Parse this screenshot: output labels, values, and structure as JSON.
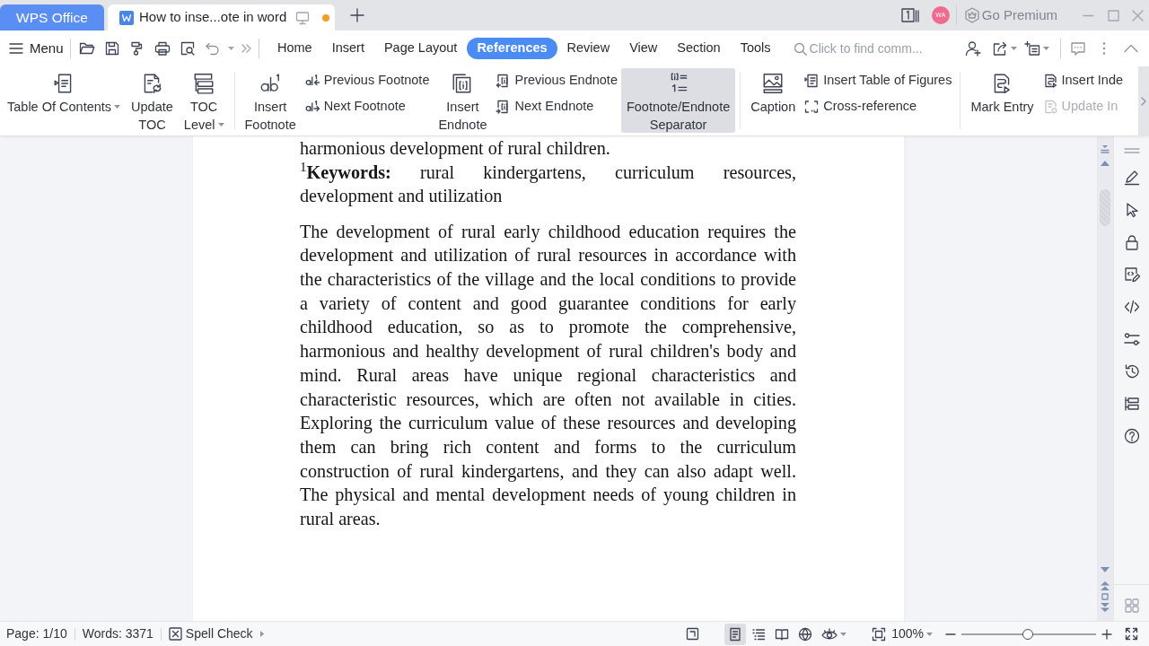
{
  "window": {
    "app_tab": "WPS Office",
    "doc_tab": {
      "title": "How to inse...ote in word",
      "modified": true
    },
    "avatar": "WA",
    "premium": "Go Premium"
  },
  "menu_bar": {
    "menu": "Menu",
    "tabs": [
      {
        "label": "Home",
        "selected": false
      },
      {
        "label": "Insert",
        "selected": false
      },
      {
        "label": "Page Layout",
        "selected": false
      },
      {
        "label": "References",
        "selected": true
      },
      {
        "label": "Review",
        "selected": false
      },
      {
        "label": "View",
        "selected": false
      },
      {
        "label": "Section",
        "selected": false
      },
      {
        "label": "Tools",
        "selected": false
      }
    ],
    "search": {
      "placeholder": "Click to find comm..."
    }
  },
  "ribbon": {
    "groups": [
      {
        "items": [
          {
            "kind": "large",
            "lines": [
              "Table Of Contents"
            ],
            "dropdown": true,
            "hovered": false
          },
          {
            "kind": "large",
            "lines": [
              "Update",
              "TOC"
            ],
            "dropdown": false,
            "hovered": false
          },
          {
            "kind": "large",
            "lines": [
              "TOC",
              "Level"
            ],
            "dropdown": true,
            "hovered": false
          }
        ]
      },
      {
        "items": [
          {
            "kind": "large",
            "lines": [
              "Insert",
              "Footnote"
            ],
            "dropdown": false,
            "hovered": false
          },
          {
            "kind": "stack",
            "entries": [
              {
                "label": "Previous Footnote",
                "disabled": false
              },
              {
                "label": "Next Footnote",
                "disabled": false
              }
            ]
          },
          {
            "kind": "large",
            "lines": [
              "Insert",
              "Endnote"
            ],
            "dropdown": false,
            "hovered": false
          },
          {
            "kind": "stack",
            "entries": [
              {
                "label": "Previous Endnote",
                "disabled": false
              },
              {
                "label": "Next Endnote",
                "disabled": false
              }
            ]
          },
          {
            "kind": "large",
            "lines": [
              "Footnote/Endnote",
              "Separator"
            ],
            "dropdown": false,
            "hovered": true
          }
        ]
      },
      {
        "items": [
          {
            "kind": "large",
            "lines": [
              "Caption"
            ],
            "dropdown": false,
            "hovered": false
          },
          {
            "kind": "stack",
            "entries": [
              {
                "label": "Insert Table of Figures",
                "disabled": false
              },
              {
                "label": "Cross-reference",
                "disabled": false
              }
            ]
          }
        ]
      },
      {
        "items": [
          {
            "kind": "large",
            "lines": [
              "Mark Entry"
            ],
            "dropdown": false,
            "hovered": false
          },
          {
            "kind": "stack",
            "entries": [
              {
                "label": "Insert Inde",
                "disabled": false
              },
              {
                "label": "Update In",
                "disabled": true
              }
            ]
          }
        ]
      }
    ]
  },
  "document": {
    "paragraphs": [
      "harmonious development of rural children.",
      "$^{1}$**Keywords:** rural kindergartens, curriculum resources, development and utilization",
      "The development of rural early childhood education requires the development and utilization of rural resources in accordance with the characteristics of the village and the local conditions to provide a variety of content and good guarantee conditions for early childhood education, so as to promote the comprehensive, harmonious and healthy development of rural children's body and mind. Rural areas have unique regional characteristics and characteristic resources, which are often not available in cities. Exploring the curriculum value of these resources and developing them can bring rich content and forms to the curriculum construction of rural kindergartens, and they can also adapt well. The physical and mental development needs of young children in rural areas."
    ]
  },
  "status_bar": {
    "page": "Page: 1/10",
    "words": "Words: 3371",
    "spell_check": "Spell Check",
    "view_modes": [
      {
        "selected": true
      },
      {
        "selected": false
      },
      {
        "selected": false
      },
      {
        "selected": false
      }
    ],
    "zoom": {
      "value": "100%",
      "level": 0.49
    }
  }
}
